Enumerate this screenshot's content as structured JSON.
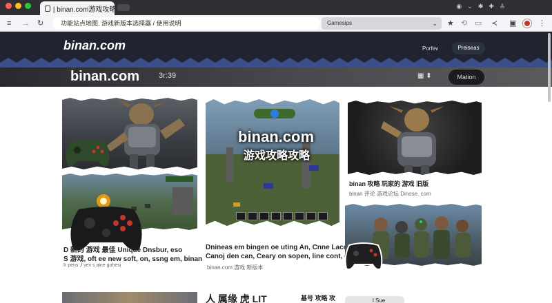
{
  "browser": {
    "tab_title": "| binan.com游戏攻略",
    "address": "功能站点地图, 游戏新版本选择器 / 使用说明",
    "search_value": "Gamesips",
    "traffic_colors": [
      "#ff5f57",
      "#febc2e",
      "#28c840"
    ]
  },
  "site": {
    "logo_small": "binan.com",
    "nav_items": [
      "Porfev",
      "Preiseas"
    ],
    "logo_large": "binan.com",
    "band_time": "3r:39",
    "band_button": "Mation"
  },
  "cards": {
    "featured_title": "binan.com",
    "featured_subtitle": "游戏攻略攻略",
    "right_heading": "binan 攻略 玩家的 游戏 旧版",
    "right_source": "binan 评论 游戏论坛 Dinose. com",
    "left_caption_1": "D 新的 游戏 最佳 Unique Dnsbur, eso",
    "left_caption_2": "S 游戏, oft ee new soft, on, ssng em, binan",
    "left_meta": "Ir pens ,f vev s aine gohesi",
    "mid_caption_1": "Dnineas em bingen oe uting An, Cnne Lace",
    "mid_caption_2": "Canoj den can, Ceary on sopen, line cont, chinoit",
    "mid_source": "binan.com 游戏 新版本",
    "bottom_heading": "人 属缘 虎 LIT",
    "bottom_meta": "基号 攻略 攻",
    "bottom_chip": "l Sue"
  },
  "colors": {
    "header_dark": "#1f2430",
    "zigzag": "#4a5f9e",
    "accent_red": "#c0392b"
  }
}
